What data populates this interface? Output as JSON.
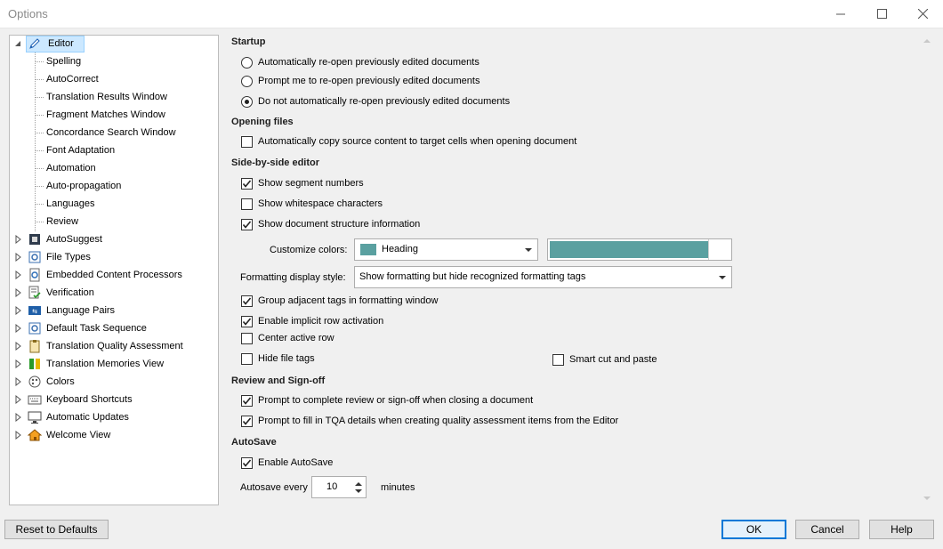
{
  "window": {
    "title": "Options",
    "minimize": "—",
    "maximize": "☐",
    "close": "✕"
  },
  "tree": {
    "root": {
      "label": "Editor",
      "icon": "pencil-icon"
    },
    "children": [
      "Spelling",
      "AutoCorrect",
      "Translation Results Window",
      "Fragment Matches Window",
      "Concordance Search Window",
      "Font Adaptation",
      "Automation",
      "Auto-propagation",
      "Languages",
      "Review"
    ],
    "groups": [
      {
        "label": "AutoSuggest",
        "icon": "autosuggest-icon"
      },
      {
        "label": "File Types",
        "icon": "file-types-icon"
      },
      {
        "label": "Embedded Content Processors",
        "icon": "gear-document-icon"
      },
      {
        "label": "Verification",
        "icon": "verification-icon"
      },
      {
        "label": "Language Pairs",
        "icon": "language-pairs-icon"
      },
      {
        "label": "Default Task Sequence",
        "icon": "task-sequence-icon"
      },
      {
        "label": "Translation Quality Assessment",
        "icon": "clipboard-icon"
      },
      {
        "label": "Translation Memories View",
        "icon": "memories-icon"
      },
      {
        "label": "Colors",
        "icon": "palette-icon"
      },
      {
        "label": "Keyboard Shortcuts",
        "icon": "keyboard-icon"
      },
      {
        "label": "Automatic Updates",
        "icon": "monitor-icon"
      },
      {
        "label": "Welcome View",
        "icon": "home-icon"
      }
    ]
  },
  "startup": {
    "title": "Startup",
    "options": [
      {
        "label": "Automatically re-open previously edited documents",
        "selected": false
      },
      {
        "label": "Prompt me to re-open previously edited documents",
        "selected": false
      },
      {
        "label": "Do not automatically re-open previously edited documents",
        "selected": true
      }
    ]
  },
  "opening_files": {
    "title": "Opening files",
    "copy_source": {
      "label": "Automatically copy source content to target cells when opening document",
      "checked": false
    }
  },
  "side_by_side": {
    "title": "Side-by-side editor",
    "show_segment_numbers": {
      "label": "Show segment numbers",
      "checked": true
    },
    "show_whitespace": {
      "label": "Show whitespace characters",
      "checked": false
    },
    "show_structure": {
      "label": "Show document structure information",
      "checked": true
    },
    "customize_colors_label": "Customize colors:",
    "customize_colors_value": "Heading",
    "color_value": "#5aa0a0",
    "formatting_style_label": "Formatting display style:",
    "formatting_style_value": "Show formatting but hide recognized formatting tags",
    "group_tags": {
      "label": "Group adjacent tags in formatting window",
      "checked": true
    },
    "implicit_row": {
      "label": "Enable implicit row activation",
      "checked": true
    },
    "center_row": {
      "label": "Center active row",
      "checked": false
    },
    "hide_file_tags": {
      "label": "Hide file tags",
      "checked": false
    },
    "smart_cut": {
      "label": "Smart cut and paste",
      "checked": false
    }
  },
  "review": {
    "title": "Review and Sign-off",
    "prompt_complete": {
      "label": "Prompt to complete review or sign-off when closing a document",
      "checked": true
    },
    "prompt_tqa": {
      "label": "Prompt to fill in TQA details when creating quality assessment items from the Editor",
      "checked": true
    }
  },
  "autosave": {
    "title": "AutoSave",
    "enable": {
      "label": "Enable AutoSave",
      "checked": true
    },
    "every_label": "Autosave every",
    "value": "10",
    "unit": "minutes"
  },
  "buttons": {
    "reset": "Reset to Defaults",
    "ok": "OK",
    "cancel": "Cancel",
    "help": "Help"
  }
}
